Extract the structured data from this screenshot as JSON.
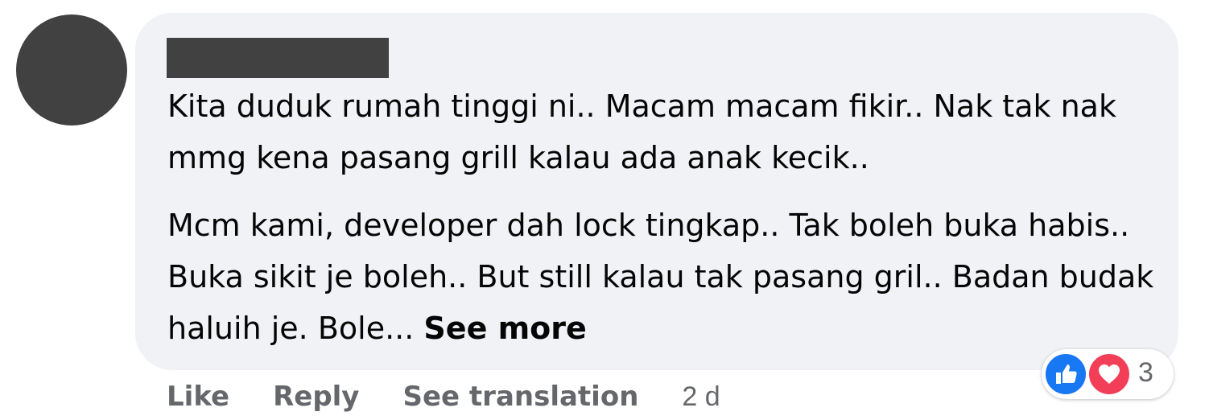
{
  "comment": {
    "paragraphs": [
      "Kita duduk rumah tinggi ni.. Macam macam fikir.. Nak tak nak mmg kena pasang grill kalau ada anak kecik..",
      "Mcm kami, developer dah lock tingkap.. Tak boleh buka habis.. Buka sikit je boleh.. But still kalau tak pasang gril.. Badan budak haluih je. Bole..."
    ],
    "see_more": "See more"
  },
  "actions": {
    "like": "Like",
    "reply": "Reply",
    "see_translation": "See translation",
    "timestamp": "2 d"
  },
  "reactions": {
    "icons": [
      "like-icon",
      "love-icon"
    ],
    "count": "3"
  },
  "colors": {
    "bubble": "#f0f2f5",
    "redacted": "#414141",
    "like_blue": "#1877f2",
    "love_red": "#f33e58",
    "secondary_text": "#65676b"
  }
}
